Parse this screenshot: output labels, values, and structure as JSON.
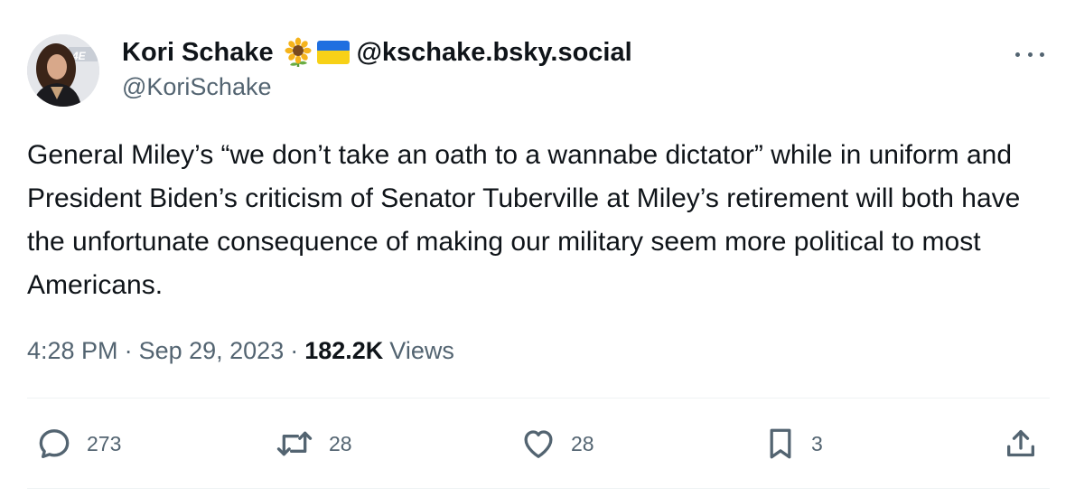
{
  "author": {
    "display_name": "Kori Schake",
    "emoji_icons": [
      "sunflower-icon",
      "ukraine-flag-icon"
    ],
    "alt_handle": "@kschake.bsky.social",
    "handle": "@KoriSchake"
  },
  "tweet": {
    "text": "General Miley’s “we don’t take an oath to a wannabe dictator” while in uniform and President Biden’s criticism of Senator Tuberville at Miley’s retirement will both have the unfortunate consequence of making our military seem more political to most Americans."
  },
  "meta": {
    "time": "4:28 PM",
    "separator": "·",
    "date": "Sep 29, 2023",
    "views_count": "182.2K",
    "views_label": "Views"
  },
  "actions": {
    "replies": {
      "icon": "reply-icon",
      "count": "273"
    },
    "reposts": {
      "icon": "repost-icon",
      "count": "28"
    },
    "likes": {
      "icon": "heart-icon",
      "count": "28"
    },
    "bookmarks": {
      "icon": "bookmark-icon",
      "count": "3"
    },
    "share": {
      "icon": "share-icon"
    }
  },
  "colors": {
    "text_primary": "#0f1419",
    "text_secondary": "#536471",
    "divider": "#eff3f4"
  }
}
